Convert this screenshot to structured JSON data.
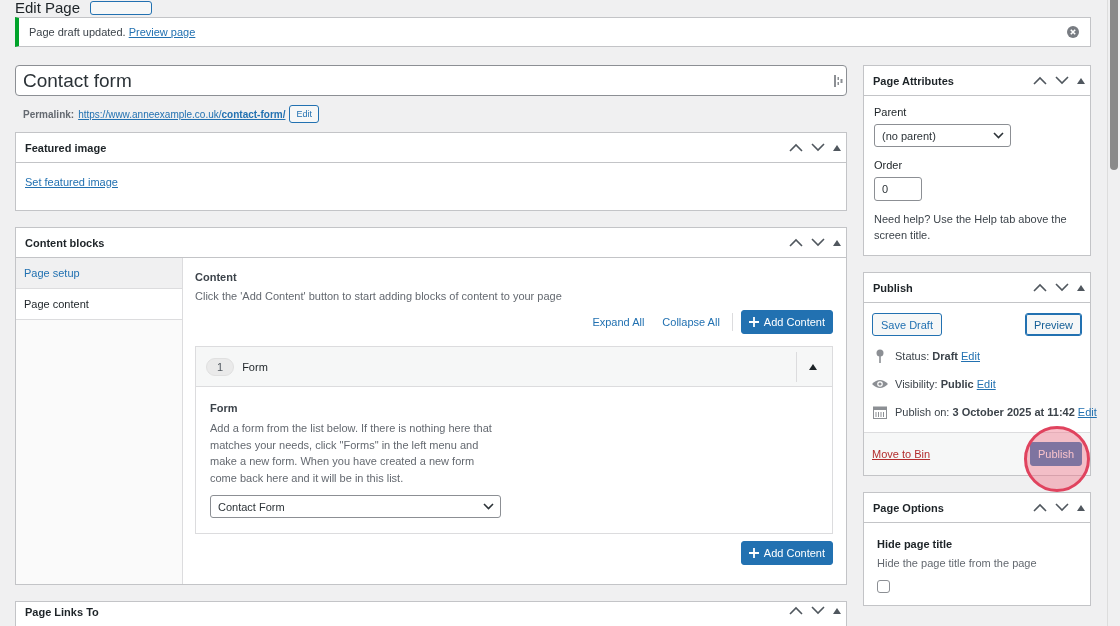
{
  "heading": {
    "title": "Edit Page"
  },
  "notice": {
    "text": "Page draft updated.",
    "link": "Preview page"
  },
  "title_field": {
    "value": "Contact form"
  },
  "permalink": {
    "label": "Permalink:",
    "url_base": "https://www.anneexample.co.uk/",
    "slug": "contact-form/",
    "edit": "Edit"
  },
  "featured_image": {
    "title": "Featured image",
    "link": "Set featured image"
  },
  "content_blocks": {
    "title": "Content blocks",
    "tabs": [
      {
        "label": "Page setup",
        "selected": false
      },
      {
        "label": "Page content",
        "selected": true
      }
    ],
    "section_label": "Content",
    "description": "Click the 'Add Content' button to start adding blocks of content to your page",
    "expand_all": "Expand All",
    "collapse_all": "Collapse All",
    "add_button": "Add Content",
    "block": {
      "number": "1",
      "title": "Form",
      "expanded": true,
      "field_label": "Form",
      "help": "Add a form from the list below. If there is nothing here that matches your needs, click \"Forms\" in the left menu and make a new form. When you have created a new form come back here and it will be in this list.",
      "select_value": "Contact Form"
    },
    "add_button_bottom": "Add Content"
  },
  "page_links_to": {
    "title": "Page Links To"
  },
  "page_attributes": {
    "title": "Page Attributes",
    "parent_label": "Parent",
    "parent_value": "(no parent)",
    "order_label": "Order",
    "order_value": "0",
    "help": "Need help? Use the Help tab above the screen title."
  },
  "publish": {
    "title": "Publish",
    "save_draft": "Save Draft",
    "preview": "Preview",
    "meta": [
      {
        "kind": "status",
        "label": "Status:",
        "value": "Draft",
        "edit": "Edit"
      },
      {
        "kind": "visibility",
        "label": "Visibility:",
        "value": "Public",
        "edit": "Edit"
      },
      {
        "kind": "schedule",
        "label": "Publish on:",
        "value": "3 October 2025 at 11:42",
        "edit": "Edit"
      }
    ],
    "move_to_bin": "Move to Bin",
    "publish_button": "Publish",
    "highlighted": true
  },
  "page_options": {
    "title": "Page Options",
    "option_label": "Hide page title",
    "option_help": "Hide the page title from the page",
    "checked": false
  }
}
